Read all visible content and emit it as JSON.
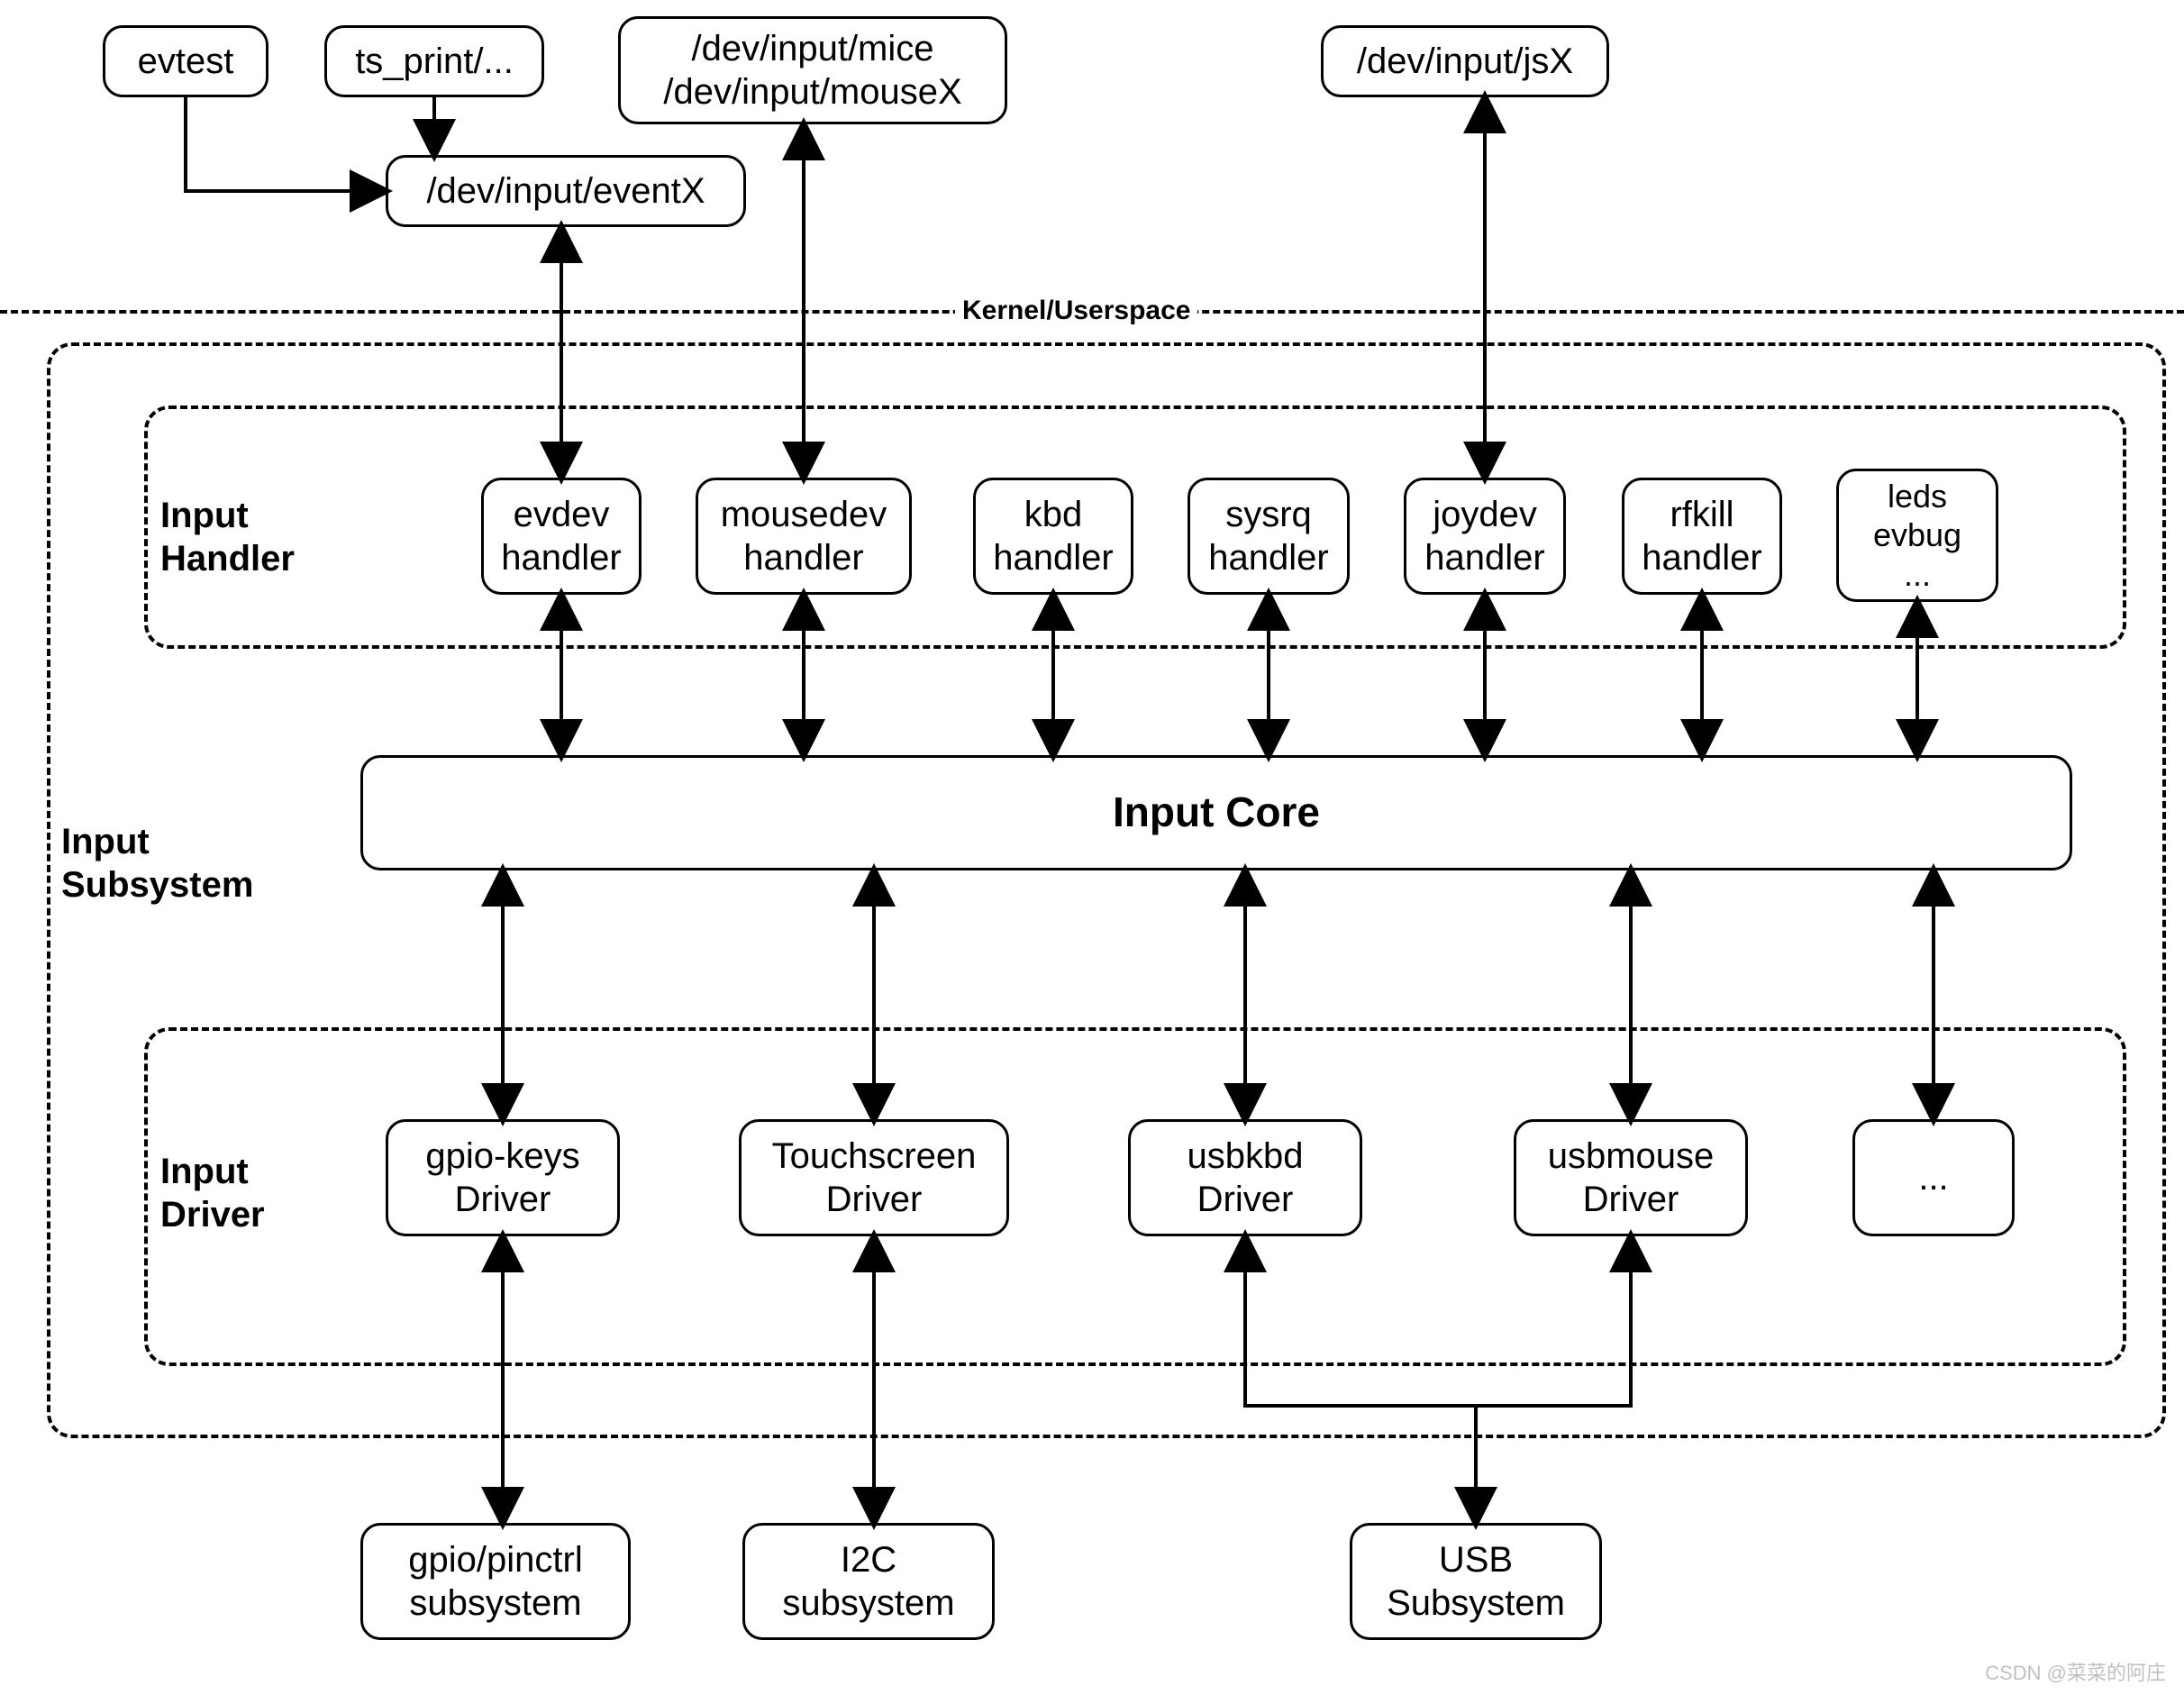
{
  "boundary_label": "Kernel/Userspace",
  "labels": {
    "subsystem": "Input\nSubsystem",
    "handler": "Input\nHandler",
    "driver": "Input\nDriver",
    "core": "Input Core"
  },
  "userspace": {
    "evtest": "evtest",
    "ts_print": "ts_print/...",
    "eventx": "/dev/input/eventX",
    "mice": "/dev/input/mice\n/dev/input/mouseX",
    "jsx": "/dev/input/jsX"
  },
  "handlers": {
    "evdev": "evdev\nhandler",
    "mousedev": "mousedev\nhandler",
    "kbd": "kbd\nhandler",
    "sysrq": "sysrq\nhandler",
    "joydev": "joydev\nhandler",
    "rfkill": "rfkill\nhandler",
    "leds": "leds\nevbug\n..."
  },
  "drivers": {
    "gpiokeys": "gpio-keys\nDriver",
    "touchscreen": "Touchscreen\nDriver",
    "usbkbd": "usbkbd\nDriver",
    "usbmouse": "usbmouse\nDriver",
    "more": "..."
  },
  "subsystems": {
    "gpio": "gpio/pinctrl\nsubsystem",
    "i2c": "I2C\nsubsystem",
    "usb": "USB\nSubsystem"
  },
  "watermark": "CSDN @菜菜的阿庄"
}
